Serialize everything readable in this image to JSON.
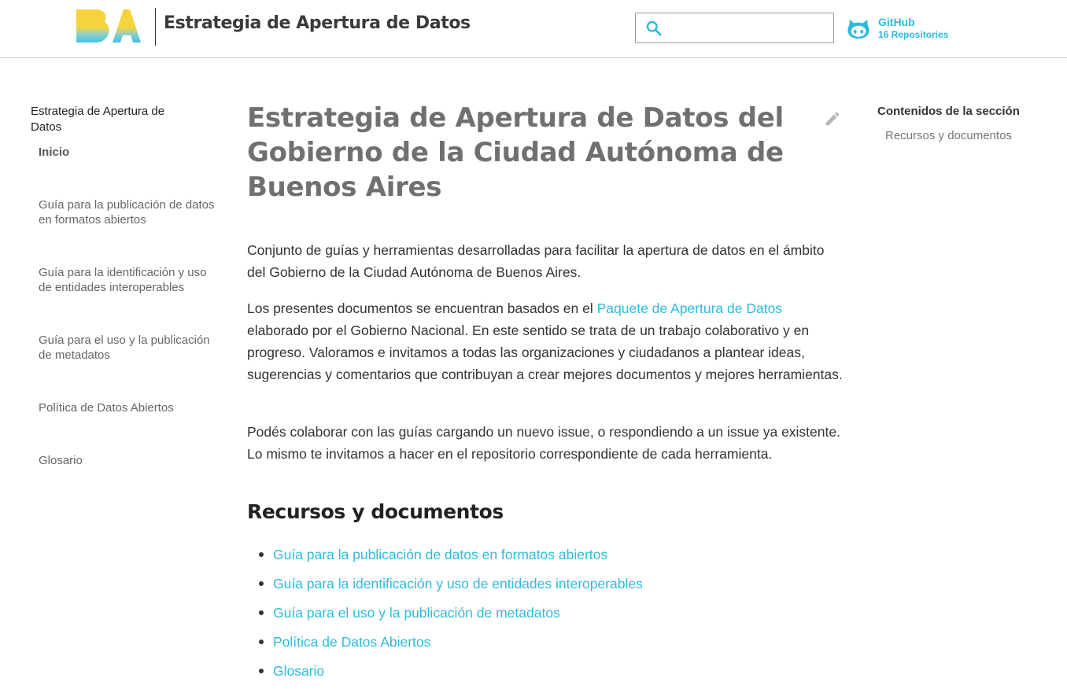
{
  "header": {
    "site_title": "Estrategia de Apertura de Datos",
    "logo_text": "BA",
    "search": {
      "value": "",
      "placeholder": ""
    },
    "github": {
      "label": "GitHub",
      "repos": "16 Repositories"
    }
  },
  "sidebar": {
    "section_title": "Estrategia de Apertura de Datos",
    "items": [
      {
        "label": "Inicio",
        "active": true
      },
      {
        "label": "Guía para la publicación de datos en formatos abiertos"
      },
      {
        "label": "Guía para la identificación y uso de entidades interoperables"
      },
      {
        "label": "Guía para el uso y la publicación de metadatos"
      },
      {
        "label": "Política de Datos Abiertos"
      },
      {
        "label": "Glosario"
      }
    ]
  },
  "main": {
    "title": "Estrategia de Apertura de Datos del Gobierno de la Ciudad Autónoma de Buenos Aires",
    "paragraphs": {
      "p1": "Conjunto de guías y herramientas desarrolladas para facilitar la apertura de datos en el ámbito del Gobierno de la Ciudad Autónoma de Buenos Aires.",
      "p2_before": "Los presentes documentos se encuentran basados en el ",
      "p2_link": "Paquete de Apertura de Datos",
      "p2_after": " elaborado por el Gobierno Nacional. En este sentido se trata de un trabajo colaborativo y en progreso. Valoramos e invitamos a todas las organizaciones y ciudadanos a plantear ideas, sugerencias y comentarios que contribuyan a crear mejores documentos y mejores herramientas.",
      "p3": "Podés colaborar con las guías cargando un nuevo issue, o respondiendo a un issue ya existente. Lo mismo te invitamos a hacer en el repositorio correspondiente de cada herramienta."
    },
    "resources_heading": "Recursos y documentos",
    "resources": [
      "Guía para la publicación de datos en formatos abiertos",
      "Guía para la identificación y uso de entidades interoperables",
      "Guía para el uso y la publicación de metadatos",
      "Política de Datos Abiertos",
      "Glosario"
    ]
  },
  "toc": {
    "title": "Contenidos de la sección",
    "items": [
      "Recursos y documentos"
    ]
  },
  "colors": {
    "accent": "#2fbadc",
    "title_gray": "#707070",
    "text": "#333333",
    "logo_yellow": "#f5d033",
    "logo_blue": "#49c4e6"
  },
  "icons": {
    "search": "search-icon",
    "github": "github-octocat-icon",
    "edit": "pencil-edit-icon"
  }
}
